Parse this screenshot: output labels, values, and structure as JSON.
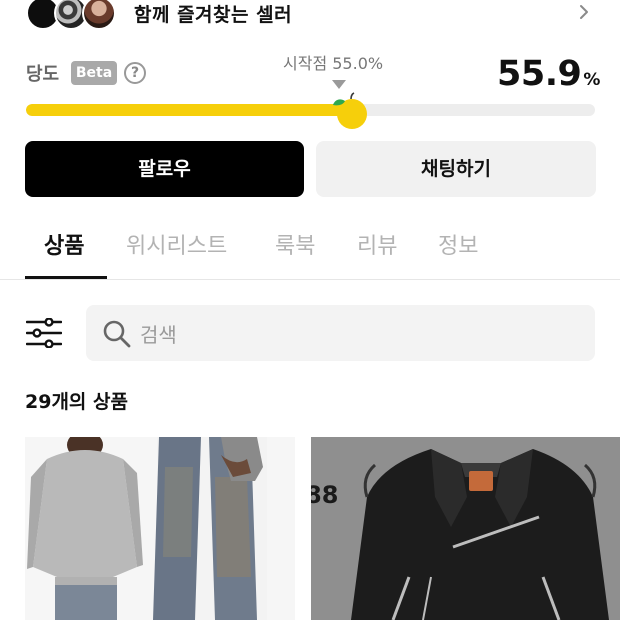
{
  "seller_section": {
    "title": "함께 즐겨찾는 셀러"
  },
  "sweetness": {
    "label": "당도",
    "beta_badge": "Beta",
    "help_glyph": "?",
    "start_label": "시작점 55.0%",
    "start_value": 55.0,
    "value": 55.9,
    "value_text": "55.9",
    "unit": "%",
    "bar_color": "#f6cf0b"
  },
  "actions": {
    "follow_label": "팔로우",
    "chat_label": "채팅하기"
  },
  "tabs": [
    {
      "label": "상품",
      "active": true
    },
    {
      "label": "위시리스트",
      "active": false
    },
    {
      "label": "룩북",
      "active": false
    },
    {
      "label": "리뷰",
      "active": false
    },
    {
      "label": "정보",
      "active": false
    }
  ],
  "search": {
    "placeholder": "검색"
  },
  "products": {
    "count_number": "29",
    "count_suffix": "개의 상품",
    "items": [
      {
        "image": "grey-sweater-denim-outfit"
      },
      {
        "image": "black-leather-biker-jacket",
        "overlay_text": "88"
      }
    ]
  },
  "icons": {
    "chevron": "chevron-right-icon",
    "help": "question-circle-icon",
    "apple": "apple-icon",
    "filter": "sliders-icon",
    "search": "search-icon"
  }
}
